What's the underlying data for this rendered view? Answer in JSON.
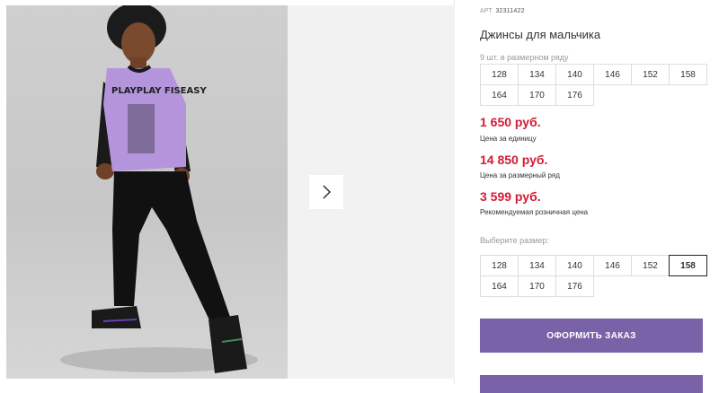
{
  "product": {
    "art_label": "АРТ.",
    "art_number": "32311422",
    "title": "Джинсы для мальчика"
  },
  "size_row": {
    "hint": "9 шт. в размерном ряду",
    "sizes": [
      "128",
      "134",
      "140",
      "146",
      "152",
      "158",
      "164",
      "170",
      "176"
    ]
  },
  "prices": [
    {
      "value": "1 650 руб.",
      "label": "Цена за единицу"
    },
    {
      "value": "14 850 руб.",
      "label": "Цена за размерный ряд"
    },
    {
      "value": "3 599 руб.",
      "label": "Рекомендуемая розничная цена"
    }
  ],
  "size_select": {
    "hint": "Выберите размер:",
    "sizes": [
      "128",
      "134",
      "140",
      "146",
      "152",
      "158",
      "164",
      "170",
      "176"
    ],
    "selected": "158"
  },
  "order_button": "ОФОРМИТЬ ЗАКАЗ",
  "photo_print_text": "PLAYPLAY FISEASY",
  "colors": {
    "accent": "#7a62a8",
    "price": "#d21b35",
    "shirt": "#b495dc"
  },
  "icons": {
    "next": "chevron-right-icon"
  }
}
